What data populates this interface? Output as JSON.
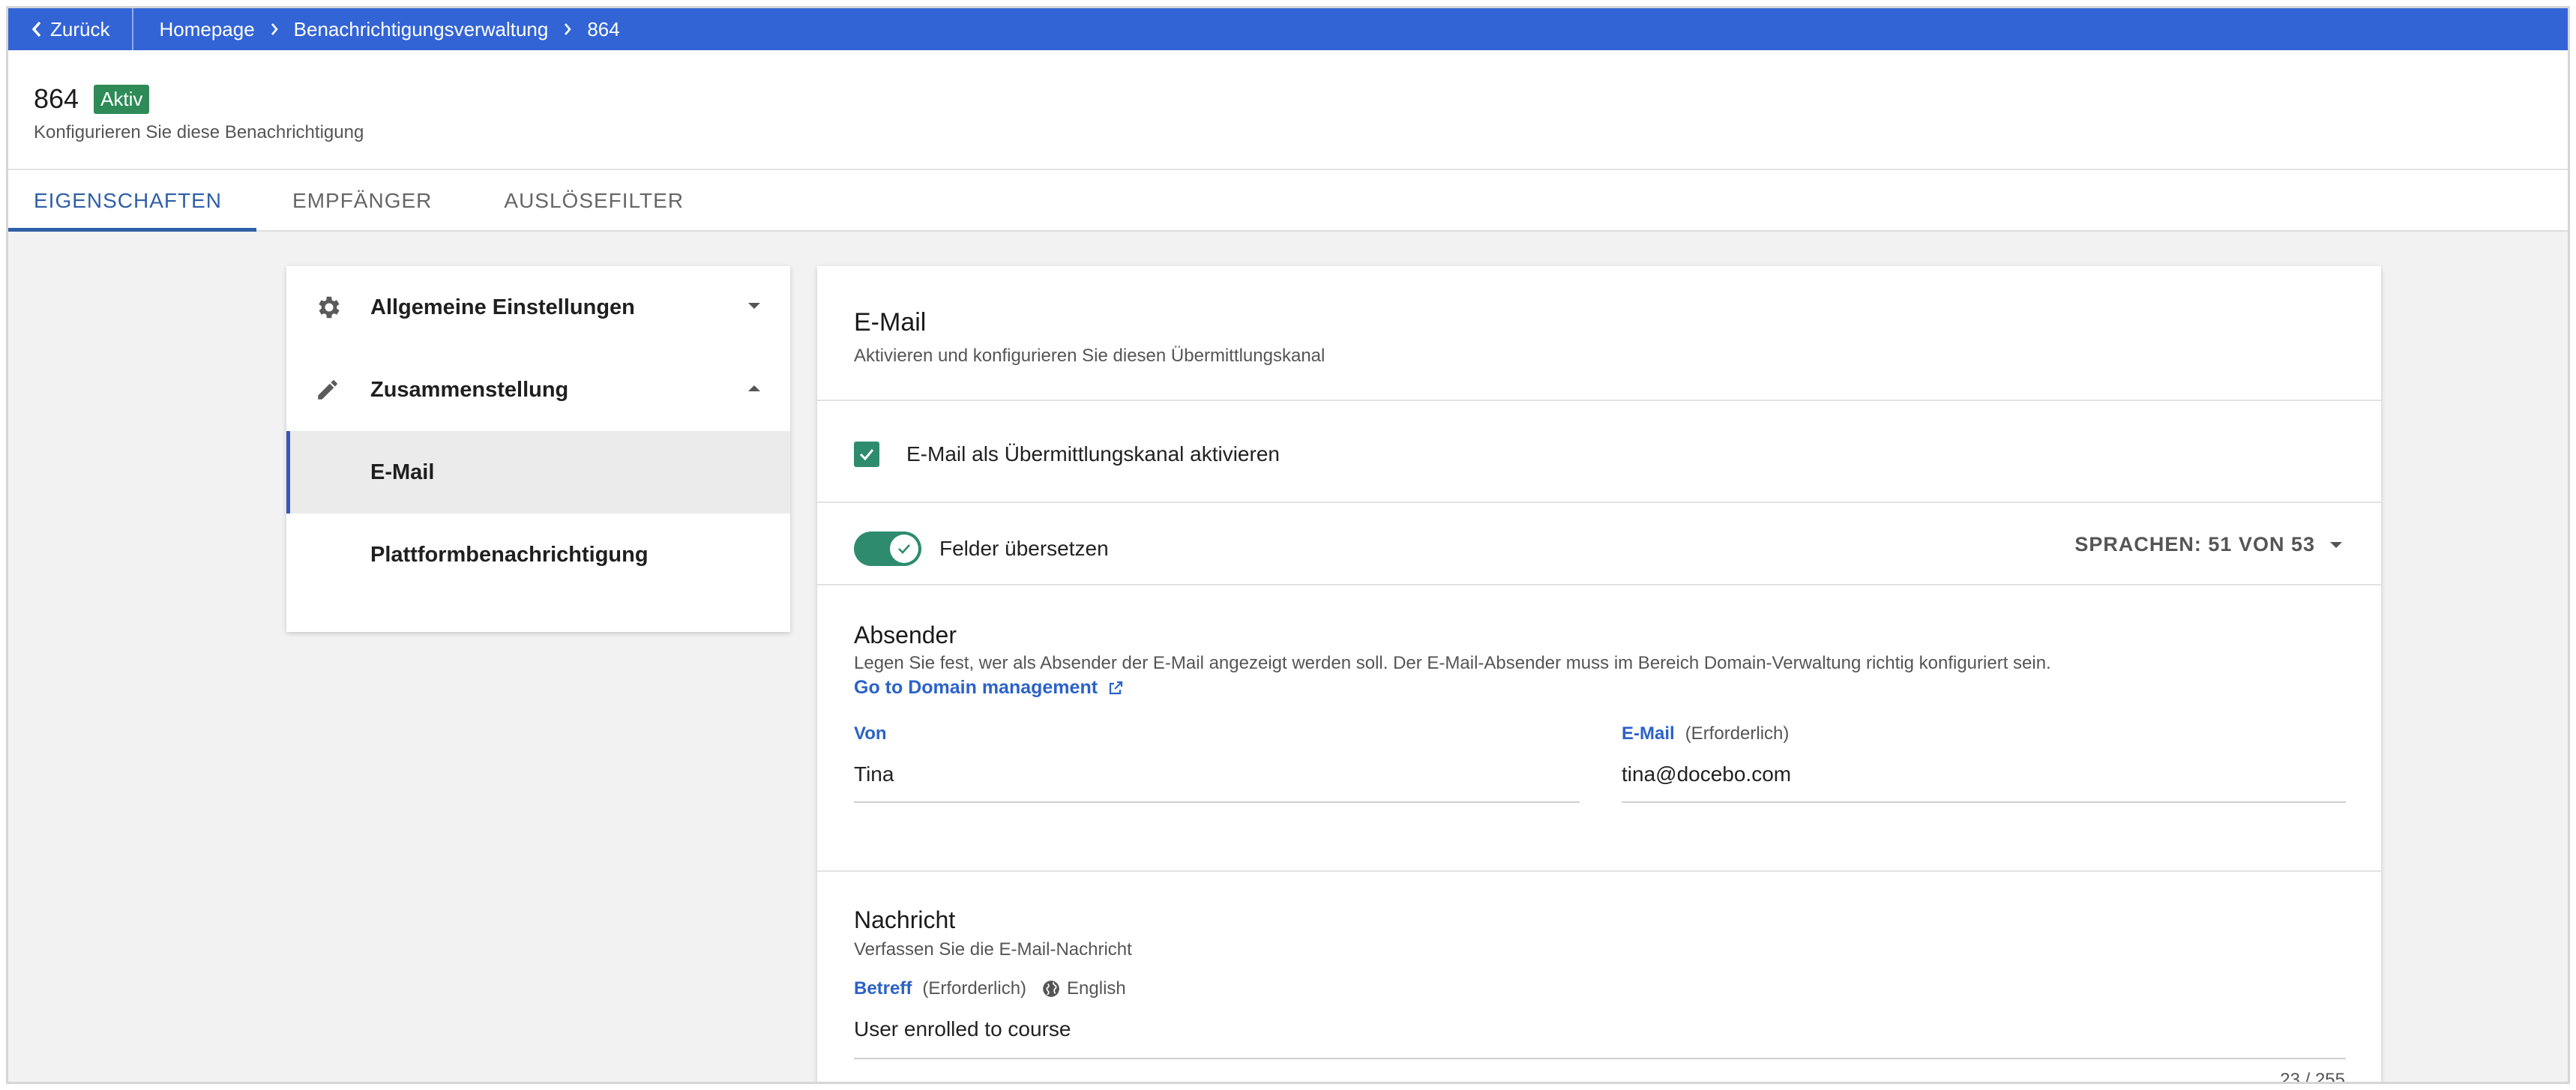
{
  "topbar": {
    "back_label": "Zurück",
    "breadcrumbs": [
      "Homepage",
      "Benachrichtigungsverwaltung",
      "864"
    ]
  },
  "header": {
    "title": "864",
    "badge": "Aktiv",
    "subtitle": "Konfigurieren Sie diese Benachrichtigung"
  },
  "tabs": [
    {
      "label": "EIGENSCHAFTEN",
      "active": true
    },
    {
      "label": "EMPFÄNGER",
      "active": false
    },
    {
      "label": "AUSLÖSEFILTER",
      "active": false
    }
  ],
  "sidebar": {
    "items": [
      {
        "label": "Allgemeine Einstellungen",
        "icon": "gear-icon"
      },
      {
        "label": "Zusammenstellung",
        "icon": "pencil-icon"
      },
      {
        "label": "E-Mail",
        "selected": true
      },
      {
        "label": "Plattformbenachrichtigung"
      }
    ]
  },
  "email": {
    "title": "E-Mail",
    "subtitle": "Aktivieren und konfigurieren Sie diesen Übermittlungskanal",
    "enable_label": "E-Mail als Übermittlungskanal aktivieren",
    "enable_checked": true,
    "translate_label": "Felder übersetzen",
    "translate_on": true,
    "languages": "SPRACHEN: 51 VON 53"
  },
  "sender": {
    "title": "Absender",
    "description": "Legen Sie fest, wer als Absender der E-Mail angezeigt werden soll. Der E-Mail-Absender muss im Bereich Domain-Verwaltung richtig konfiguriert sein.",
    "link": "Go to Domain management",
    "from_label": "Von",
    "from_value": "Tina",
    "email_label": "E-Mail",
    "email_required": "(Erforderlich)",
    "email_value": "tina@docebo.com"
  },
  "message": {
    "title": "Nachricht",
    "subtitle": "Verfassen Sie die E-Mail-Nachricht",
    "subject_label": "Betreff",
    "subject_required": "(Erforderlich)",
    "subject_language": "English",
    "subject_value": "User enrolled to course",
    "counter": "23 / 255"
  },
  "colors": {
    "topbar": "#3364d6",
    "accent": "#2f5fa8",
    "badge": "#2e8b57",
    "toggle": "#2e8b6e",
    "link": "#2b62c9"
  }
}
